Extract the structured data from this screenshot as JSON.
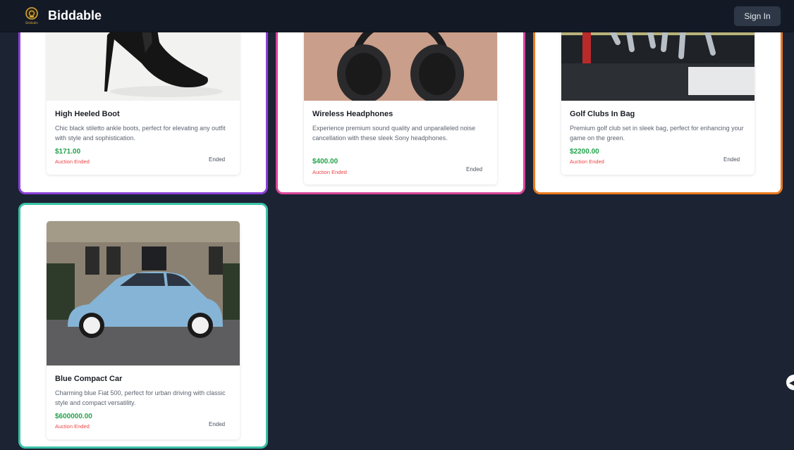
{
  "navbar": {
    "brand": "Biddable",
    "logo_text": "Biddable",
    "signin_label": "Sign In"
  },
  "auctions": [
    {
      "title": "High Heeled Boot",
      "description": "Chic black stiletto ankle boots, perfect for elevating any outfit with style and sophistication.",
      "price": "$171.00",
      "status": "Auction Ended",
      "badge": "Ended",
      "border_color": "#8b3fd9",
      "image_icon": "boot-image"
    },
    {
      "title": "Wireless Headphones",
      "description": "Experience premium sound quality and unparalleled noise cancellation with these sleek Sony headphones.",
      "price": "$400.00",
      "status": "Auction Ended",
      "badge": "Ended",
      "border_color": "#d9459a",
      "image_icon": "headphones-image"
    },
    {
      "title": "Golf Clubs In Bag",
      "description": "Premium golf club set in sleek bag, perfect for enhancing your game on the green.",
      "price": "$2200.00",
      "status": "Auction Ended",
      "badge": "Ended",
      "border_color": "#ea7a1c",
      "image_icon": "golf-clubs-image"
    },
    {
      "title": "Blue Compact Car",
      "description": "Charming blue Fiat 500, perfect for urban driving with classic style and compact versatility.",
      "price": "$600000.00",
      "status": "Auction Ended",
      "badge": "Ended",
      "border_color": "#3bc0a6",
      "image_icon": "blue-car-image"
    }
  ],
  "scroll_icon": "chevron-left-icon"
}
